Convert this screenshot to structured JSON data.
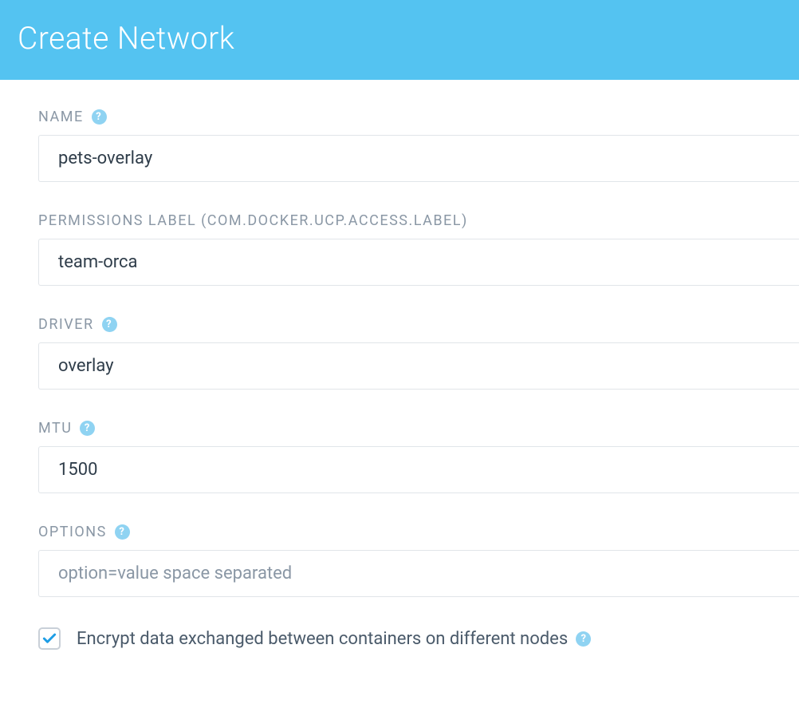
{
  "header": {
    "title": "Create Network"
  },
  "form": {
    "name": {
      "label": "NAME",
      "value": "pets-overlay",
      "has_help": true
    },
    "permissions_label": {
      "label": "PERMISSIONS LABEL (COM.DOCKER.UCP.ACCESS.LABEL)",
      "value": "team-orca",
      "has_help": false
    },
    "driver": {
      "label": "DRIVER",
      "value": "overlay",
      "has_help": true
    },
    "mtu": {
      "label": "MTU",
      "value": "1500",
      "has_help": true
    },
    "options": {
      "label": "OPTIONS",
      "value": "",
      "placeholder": "option=value space separated",
      "has_help": true
    },
    "encrypt": {
      "label": "Encrypt data exchanged between containers on different nodes",
      "checked": true,
      "has_help": true
    }
  },
  "colors": {
    "header_bg": "#54c3f1",
    "label_text": "#8a97a5",
    "input_text": "#2f3d4a",
    "help_bg": "#8fd3f2",
    "checkbox_check": "#1e9ee6"
  }
}
